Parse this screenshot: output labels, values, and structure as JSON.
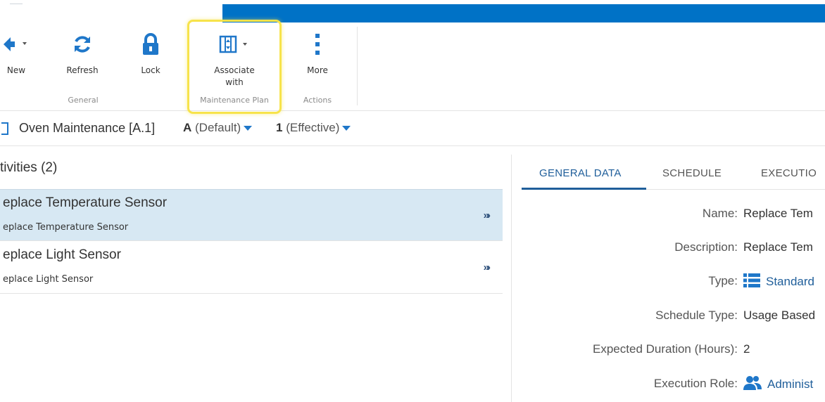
{
  "ribbon": {
    "new_label": "New",
    "refresh_label": "Refresh",
    "lock_label": "Lock",
    "associate_label_line1": "Associate",
    "associate_label_line2": "with",
    "more_label": "More",
    "group_general": "General",
    "group_maintenance_plan": "Maintenance Plan",
    "group_actions": "Actions"
  },
  "crumb": {
    "title": "Oven Maintenance [A.1]",
    "revision_letter": "A",
    "revision_name": "(Default)",
    "iteration_number": "1",
    "iteration_state": "(Effective)"
  },
  "activities": {
    "header": "tivities (2)",
    "items": [
      {
        "title": "eplace Temperature Sensor",
        "subtitle": "eplace Temperature Sensor",
        "chevron": "»›"
      },
      {
        "title": "eplace Light Sensor",
        "subtitle": "eplace Light Sensor",
        "chevron": "»›"
      }
    ]
  },
  "tabs": {
    "general": "GENERAL DATA",
    "schedule": "SCHEDULE",
    "execution": "EXECUTIO"
  },
  "fields": {
    "name_label": "Name:",
    "name_value": "Replace Tem",
    "description_label": "Description:",
    "description_value": "Replace Tem",
    "type_label": "Type:",
    "type_value": "Standard",
    "schedule_type_label": "Schedule Type:",
    "schedule_type_value": "Usage Based",
    "duration_label": "Expected Duration (Hours):",
    "duration_value": "2",
    "execution_role_label": "Execution Role:",
    "execution_role_value": "Administ"
  },
  "colors": {
    "accent_blue": "#0072c6",
    "highlight_yellow": "#f7e34b",
    "selected_row": "#d7e8f3",
    "link_blue": "#1f5e9a"
  }
}
